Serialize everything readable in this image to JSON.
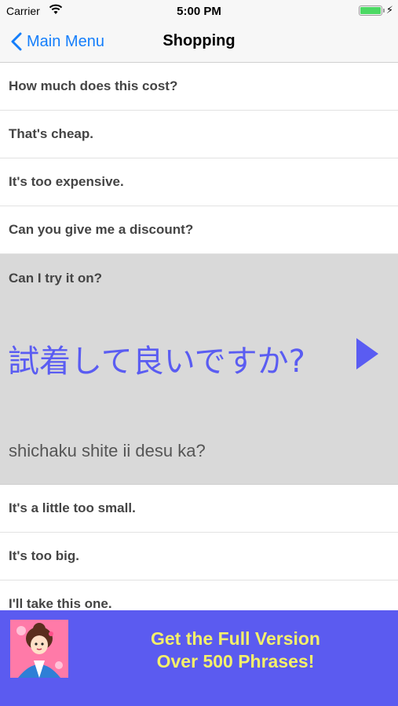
{
  "status_bar": {
    "carrier": "Carrier",
    "time": "5:00 PM",
    "battery_level": 1.0
  },
  "nav": {
    "back_label": "Main Menu",
    "title": "Shopping"
  },
  "phrases_before": [
    "How much does this cost?",
    "That's cheap.",
    "It's too expensive.",
    "Can you give me a discount?"
  ],
  "selected": {
    "english": "Can I try it on?",
    "japanese": "試着して良いですか?",
    "romaji": "shichaku shite ii desu ka?"
  },
  "phrases_after": [
    "It's a little too small.",
    "It's too big.",
    "I'll take this one."
  ],
  "banner": {
    "line1": "Get the Full Version",
    "line2": "Over 500 Phrases!"
  },
  "colors": {
    "accent": "#147efb",
    "japanese_text": "#5a5cf2",
    "banner_bg": "#5b5bf0",
    "banner_text": "#f4f06a",
    "selected_bg": "#d9d9d9"
  },
  "icons": {
    "wifi": "wifi-icon",
    "battery": "battery-icon",
    "back": "chevron-left-icon",
    "play": "play-icon",
    "avatar": "kimono-girl-illustration"
  }
}
